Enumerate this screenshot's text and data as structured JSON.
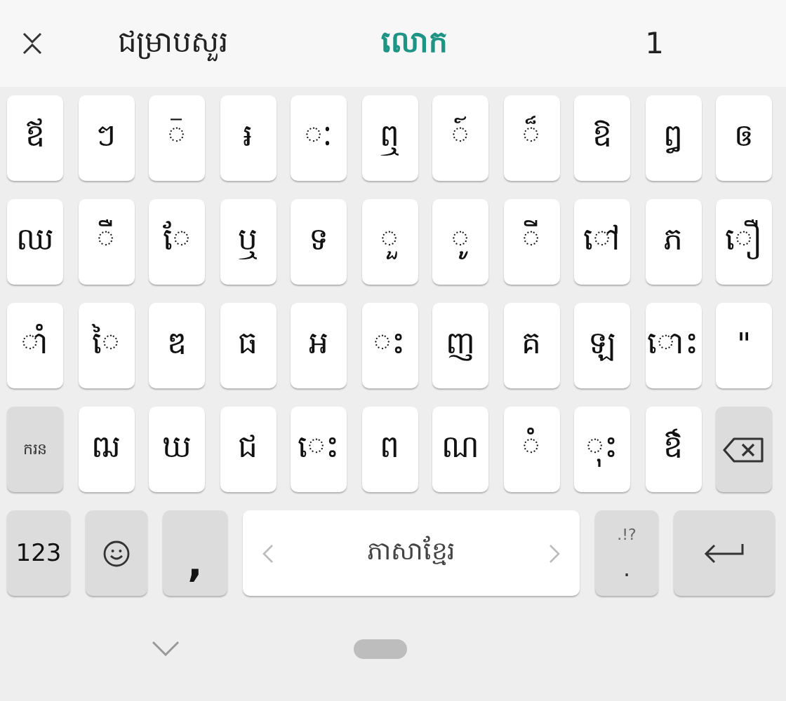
{
  "suggestion_bar": {
    "close": true,
    "suggestions": [
      {
        "text": "ជម្រាបសួរ",
        "selected": false
      },
      {
        "text": "លោក",
        "selected": true
      },
      {
        "text": "1",
        "selected": false
      }
    ]
  },
  "keyboard": {
    "rows": [
      [
        {
          "kind": "char",
          "label": "ឪ"
        },
        {
          "kind": "char",
          "label": "ៗ"
        },
        {
          "kind": "char",
          "label": "◌៑"
        },
        {
          "kind": "char",
          "label": "៛"
        },
        {
          "kind": "char",
          "label": "◌ៈ"
        },
        {
          "kind": "char",
          "label": "ឮ"
        },
        {
          "kind": "char",
          "label": "៍"
        },
        {
          "kind": "char",
          "label": "◌៏"
        },
        {
          "kind": "char",
          "label": "ឱ"
        },
        {
          "kind": "char",
          "label": "ឰ"
        },
        {
          "kind": "char",
          "label": "ឲ"
        }
      ],
      [
        {
          "kind": "char",
          "label": "ឈ"
        },
        {
          "kind": "char",
          "label": "◌ឺ"
        },
        {
          "kind": "char",
          "label": "◌ែ"
        },
        {
          "kind": "char",
          "label": "ឬ"
        },
        {
          "kind": "char",
          "label": "ទ"
        },
        {
          "kind": "char",
          "label": "◌ួ"
        },
        {
          "kind": "char",
          "label": "◌ូ"
        },
        {
          "kind": "char",
          "label": "◌ី"
        },
        {
          "kind": "char",
          "label": "◌ៅ"
        },
        {
          "kind": "char",
          "label": "ភ"
        },
        {
          "kind": "char",
          "label": "◌ឿ"
        }
      ],
      [
        {
          "kind": "char",
          "label": "◌ាំ"
        },
        {
          "kind": "char",
          "label": "◌ៃ"
        },
        {
          "kind": "char",
          "label": "ឌ"
        },
        {
          "kind": "char",
          "label": "ធ"
        },
        {
          "kind": "char",
          "label": "អ"
        },
        {
          "kind": "char",
          "label": "◌ះ"
        },
        {
          "kind": "char",
          "label": "ញ"
        },
        {
          "kind": "char",
          "label": "គ"
        },
        {
          "kind": "char",
          "label": "ឡ"
        },
        {
          "kind": "char",
          "label": "◌ោះ"
        },
        {
          "kind": "char",
          "label": "\""
        }
      ],
      [
        {
          "kind": "shift",
          "label": "ករន"
        },
        {
          "kind": "char",
          "label": "ឍ"
        },
        {
          "kind": "char",
          "label": "ឃ"
        },
        {
          "kind": "char",
          "label": "ជ"
        },
        {
          "kind": "char",
          "label": "◌េះ"
        },
        {
          "kind": "char",
          "label": "ព"
        },
        {
          "kind": "char",
          "label": "ណ"
        },
        {
          "kind": "char",
          "label": "◌ំ"
        },
        {
          "kind": "char",
          "label": "◌ុះ"
        },
        {
          "kind": "char",
          "label": "ឳ"
        },
        {
          "kind": "backspace"
        }
      ]
    ],
    "bottom_row": [
      {
        "kind": "numbers",
        "label": "123"
      },
      {
        "kind": "emoji"
      },
      {
        "kind": "comma",
        "label": ","
      },
      {
        "kind": "space",
        "label": "ភាសាខ្មែរ"
      },
      {
        "kind": "period",
        "label": ".",
        "hint": ".!?"
      },
      {
        "kind": "enter"
      }
    ]
  },
  "nav_bar": {
    "collapse": true,
    "home": true
  }
}
